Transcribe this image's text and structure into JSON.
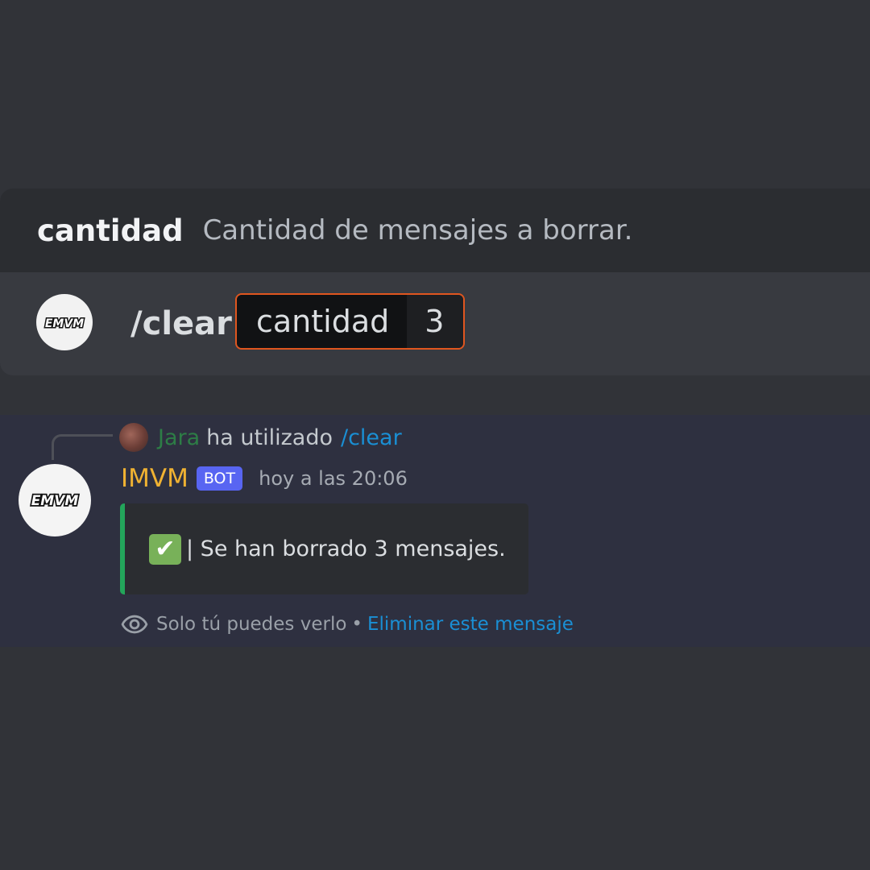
{
  "command_hint": {
    "option_name": "cantidad",
    "option_description": "Cantidad de mensajes a borrar."
  },
  "command_input": {
    "avatar_logo_text": "EMVM",
    "command": "/clear",
    "option_name": "cantidad",
    "option_value": "3"
  },
  "message": {
    "reply": {
      "user": "Jara",
      "text": "ha utilizado",
      "command": "/clear"
    },
    "author": "IMVM",
    "bot_tag": "BOT",
    "avatar_logo_text": "EMVM",
    "timestamp": "hoy a las 20:06",
    "embed": {
      "emoji": "✔",
      "text": "| Se han borrado 3 mensajes.",
      "accent_color": "#23a55a"
    },
    "ephemeral": {
      "icon": "eye-icon",
      "text": "Solo tú puedes verlo",
      "separator": "•",
      "link": "Eliminar este mensaje"
    }
  },
  "colors": {
    "background": "#313338",
    "author": "#f0b232",
    "link": "#1a8fd4",
    "highlight_border": "#e0561f",
    "bot_tag": "#5865f2"
  }
}
